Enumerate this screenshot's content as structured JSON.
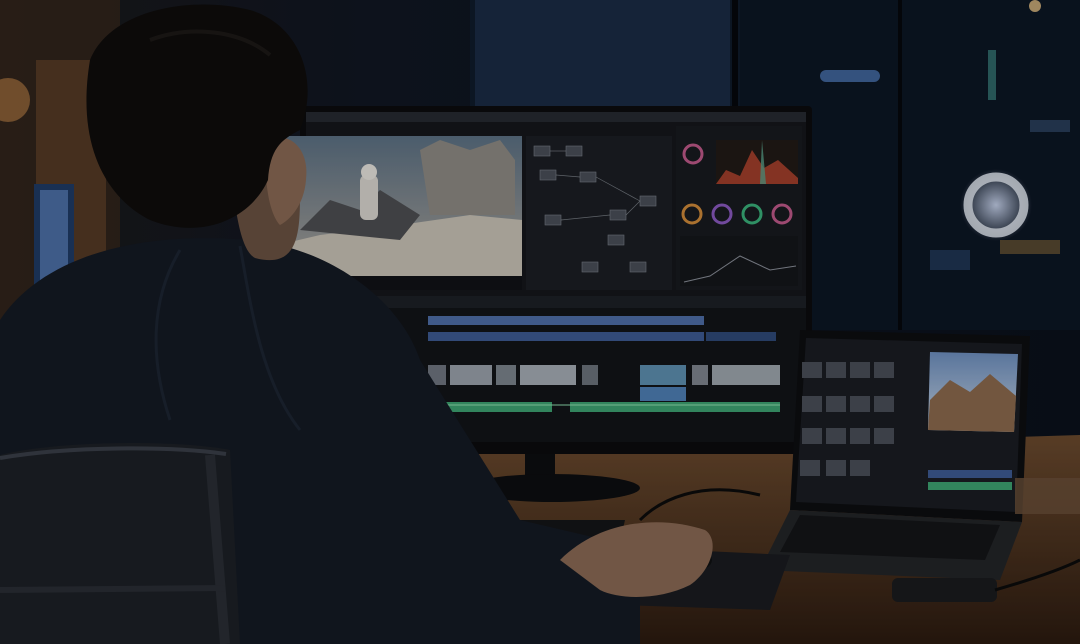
{
  "scene": {
    "subject": "person-at-editing-workstation",
    "colors": {
      "room": "#0c1119",
      "window_blue": "#1a2c44",
      "warm_light": "#b88450",
      "desk": "#5a3a22",
      "desk_dark": "#2c1b10",
      "monitor_bezel": "#0b0c0e",
      "ui_panel": "#1c1f25",
      "ui_panel_dark": "#121418",
      "accent_blue": "#4f6ea8",
      "accent_green": "#3ea372",
      "shirt": "#141a24",
      "hair": "#0f0d0c",
      "skin": "#8a6a55",
      "chair": "#1d2026"
    },
    "icons": [
      "color-wheel-icon",
      "node-icon",
      "waveform-icon"
    ]
  }
}
